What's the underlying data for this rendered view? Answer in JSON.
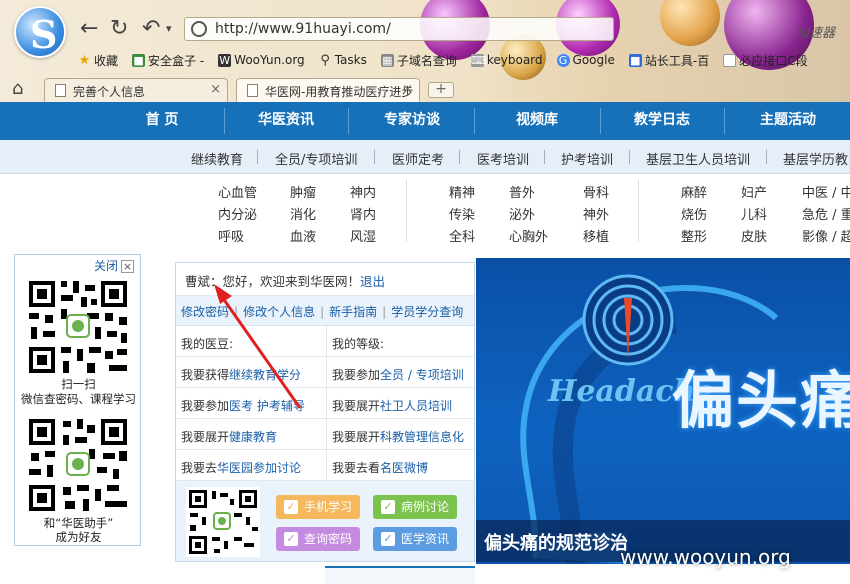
{
  "browser": {
    "url": "http://www.91huayi.com/",
    "accelerator": "加速器",
    "bookmarks": [
      "收藏",
      "安全盒子 -",
      "WooYun.org",
      "Tasks",
      "子域名查询",
      "keyboard",
      "Google",
      "站长工具-百",
      "必应接口C段"
    ],
    "tabs": [
      {
        "title": "完善个人信息"
      },
      {
        "title": "华医网-用教育推动医疗进步"
      }
    ],
    "new_tab": "+"
  },
  "nav": {
    "main": [
      "首 页",
      "华医资讯",
      "专家访谈",
      "视频库",
      "教学日志",
      "主题活动"
    ],
    "sub": [
      "继续教育",
      "全员/专项培训",
      "医师定考",
      "医考培训",
      "护考培训",
      "基层卫生人员培训",
      "基层学历教"
    ]
  },
  "categories": {
    "col1": [
      "心血管",
      "内分泌",
      "呼吸"
    ],
    "col2": [
      "肿瘤",
      "消化",
      "血液"
    ],
    "col3": [
      "神内",
      "肾内",
      "风湿"
    ],
    "col4": [
      "精神",
      "传染",
      "全科"
    ],
    "col5": [
      "普外",
      "泌外",
      "心胸外"
    ],
    "col6": [
      "骨科",
      "神外",
      "移植"
    ],
    "col7": [
      "麻醉",
      "烧伤",
      "整形"
    ],
    "col8": [
      "妇产",
      "儿科",
      "皮肤"
    ],
    "col9": [
      "中医 / 中",
      "急危 / 重",
      "影像 / 超"
    ]
  },
  "left_panel": {
    "close": "关闭",
    "close_x": "×",
    "caption1_line1": "扫一扫",
    "caption1_line2": "微信查密码、课程学习",
    "caption2_line1": "和“华医助手”",
    "caption2_line2": "成为好友"
  },
  "user": {
    "name": "曹斌",
    "greeting": "：您好，欢迎来到华医网！",
    "logout": "退出",
    "links": [
      "修改密码",
      "修改个人信息",
      "新手指南",
      "学员学分查询"
    ],
    "cells": [
      {
        "pre": "我的医豆:",
        "link": ""
      },
      {
        "pre": "我的等级:",
        "link": ""
      },
      {
        "pre": "我要获得",
        "link": "继续教育学分"
      },
      {
        "pre": "我要参加",
        "link": "全员 / 专项培训"
      },
      {
        "pre": "我要参加",
        "link": "医考 护考辅导"
      },
      {
        "pre": "我要展开",
        "link": "社卫人员培训"
      },
      {
        "pre": "我要展开",
        "link": "健康教育"
      },
      {
        "pre": "我要展开",
        "link": "科教管理信息化"
      },
      {
        "pre": "我要去",
        "link": "华医园参加讨论"
      },
      {
        "pre": "我要去看",
        "link": "名医微博"
      }
    ],
    "chips": [
      {
        "label": "手机学习",
        "color": "#f5b85c"
      },
      {
        "label": "病例讨论",
        "color": "#7cc24f"
      },
      {
        "label": "查询密码",
        "color": "#c58be0"
      },
      {
        "label": "医学资讯",
        "color": "#5b9de0"
      }
    ]
  },
  "banner": {
    "english": "Headache",
    "chinese": "偏头痛",
    "caption": "偏头痛的规范诊治"
  },
  "watermark": "www.wooyun.org"
}
